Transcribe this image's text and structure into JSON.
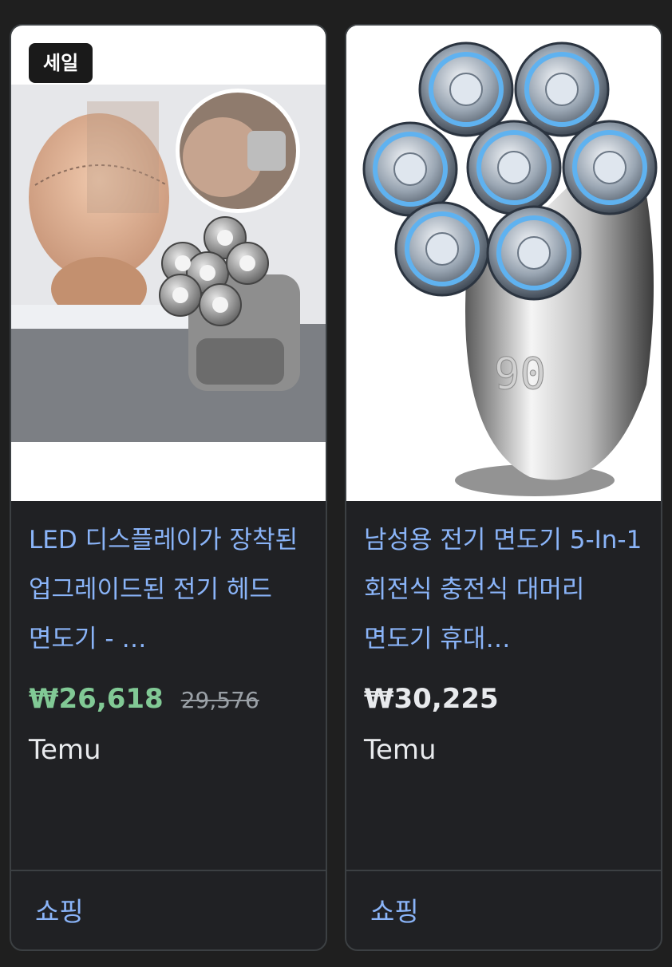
{
  "cards": [
    {
      "badge": "세일",
      "title": "LED 디스플레이가 장착된 업그레이드된 전기 헤드 면도기 - …",
      "price": "₩26,618",
      "original_price": "29,576",
      "merchant": "Temu",
      "footer_label": "쇼핑",
      "price_color": "#81c995"
    },
    {
      "title": "남성용 전기 면도기 5-In-1 회전식 충전식 대머리 면도기 휴대…",
      "price": "₩30,225",
      "merchant": "Temu",
      "footer_label": "쇼핑",
      "display_digits": "90",
      "price_color": "#e8eaed"
    }
  ],
  "colors": {
    "background": "#1f1f1f",
    "card": "#202124",
    "link": "#8ab4f8",
    "sale_price": "#81c995"
  }
}
